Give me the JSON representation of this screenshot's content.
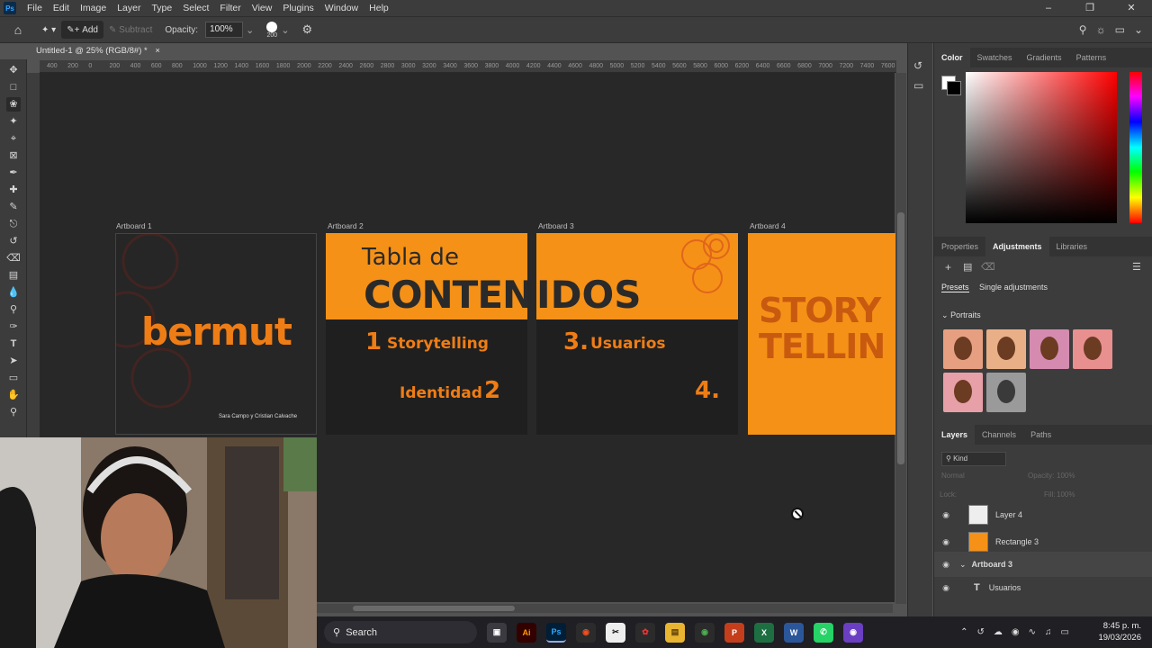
{
  "menubar": {
    "items": [
      "File",
      "Edit",
      "Image",
      "Layer",
      "Type",
      "Select",
      "Filter",
      "View",
      "Plugins",
      "Window",
      "Help"
    ]
  },
  "options_bar": {
    "add_label": "Add",
    "subtract_label": "Subtract",
    "opacity_label": "Opacity:",
    "opacity_value": "100%",
    "brush_size": "200"
  },
  "document": {
    "tab_title": "Untitled-1 @ 25% (RGB/8#) *",
    "ruler_ticks": [
      "400",
      "200",
      "0",
      "200",
      "400",
      "600",
      "800",
      "1000",
      "1200",
      "1400",
      "1600",
      "1800",
      "2000",
      "2200",
      "2400",
      "2600",
      "2800",
      "3000",
      "3200",
      "3400",
      "3600",
      "3800",
      "4000",
      "4200",
      "4400",
      "4600",
      "4800",
      "5000",
      "5200",
      "5400",
      "5600",
      "5800",
      "6000",
      "6200",
      "6400",
      "6600",
      "6800",
      "7000",
      "7200",
      "7400",
      "7600"
    ]
  },
  "artboards": {
    "ab1": {
      "label": "Artboard 1",
      "title": "bermut",
      "credits": "Sara Campo y Cristian Calvache"
    },
    "ab2": {
      "label": "Artboard 2",
      "heading": "Tabla de",
      "big": "CONTENIDOS",
      "item1_num": "1",
      "item1": "Storytelling",
      "item2": "Identidad",
      "item2_num": "2"
    },
    "ab3": {
      "label": "Artboard 3",
      "item3_num": "3.",
      "item3": "Usuarios",
      "item4_num": "4."
    },
    "ab4": {
      "label": "Artboard 4",
      "line1": "STORY",
      "line2": "TELLIN"
    }
  },
  "right_panel": {
    "color_tabs": [
      "Color",
      "Swatches",
      "Gradients",
      "Patterns"
    ],
    "adj_tabs": [
      "Properties",
      "Adjustments",
      "Libraries"
    ],
    "presets_tab": "Presets",
    "single_adj_tab": "Single adjustments",
    "portraits_label": "Portraits",
    "layer_tabs": [
      "Layers",
      "Channels",
      "Paths"
    ],
    "kind_label": "Kind",
    "blend_mode": "Normal",
    "opacity_label": "Opacity:",
    "opacity_value": "100%",
    "lock_label": "Lock:",
    "fill_label": "Fill:",
    "fill_value": "100%",
    "layers": [
      "Layer 4",
      "Rectangle 3",
      "Artboard 3",
      "Usuarios"
    ]
  },
  "taskbar": {
    "search_label": "Search",
    "time": "8:45 p. m.",
    "date": "19/03/2026"
  },
  "colors": {
    "accent_orange": "#f59117",
    "ps_blue": "#31a8ff",
    "panel_bg": "#3c3c3c"
  }
}
